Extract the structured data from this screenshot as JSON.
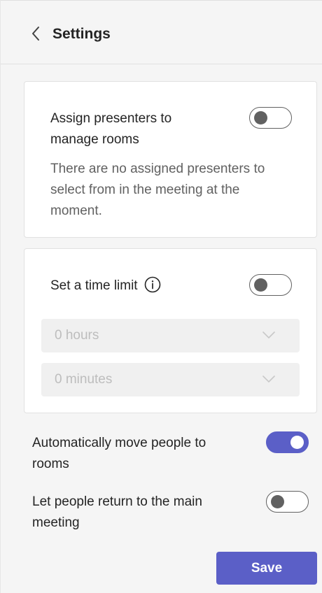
{
  "header": {
    "title": "Settings"
  },
  "assign_presenters": {
    "label_line1": "Assign presenters to",
    "label_line2": "manage rooms",
    "desc_line1": "There are no assigned presenters to",
    "desc_line2": "select from in the meeting at the",
    "desc_line3": "moment.",
    "enabled": false
  },
  "time_limit": {
    "label": "Set a time limit",
    "enabled": false,
    "hours": "0 hours",
    "minutes": "0 minutes"
  },
  "auto_move": {
    "label_line1": "Automatically move people to",
    "label_line2": "rooms",
    "enabled": true
  },
  "return_main": {
    "label_line1": "Let people return to the main",
    "label_line2": "meeting",
    "enabled": false
  },
  "actions": {
    "save_label": "Save"
  },
  "colors": {
    "accent": "#5b5fc7",
    "toggle_off": "#616161"
  },
  "icons": {
    "back": "chevron-left-icon",
    "info": "info-icon",
    "dropdown": "chevron-down-icon"
  }
}
